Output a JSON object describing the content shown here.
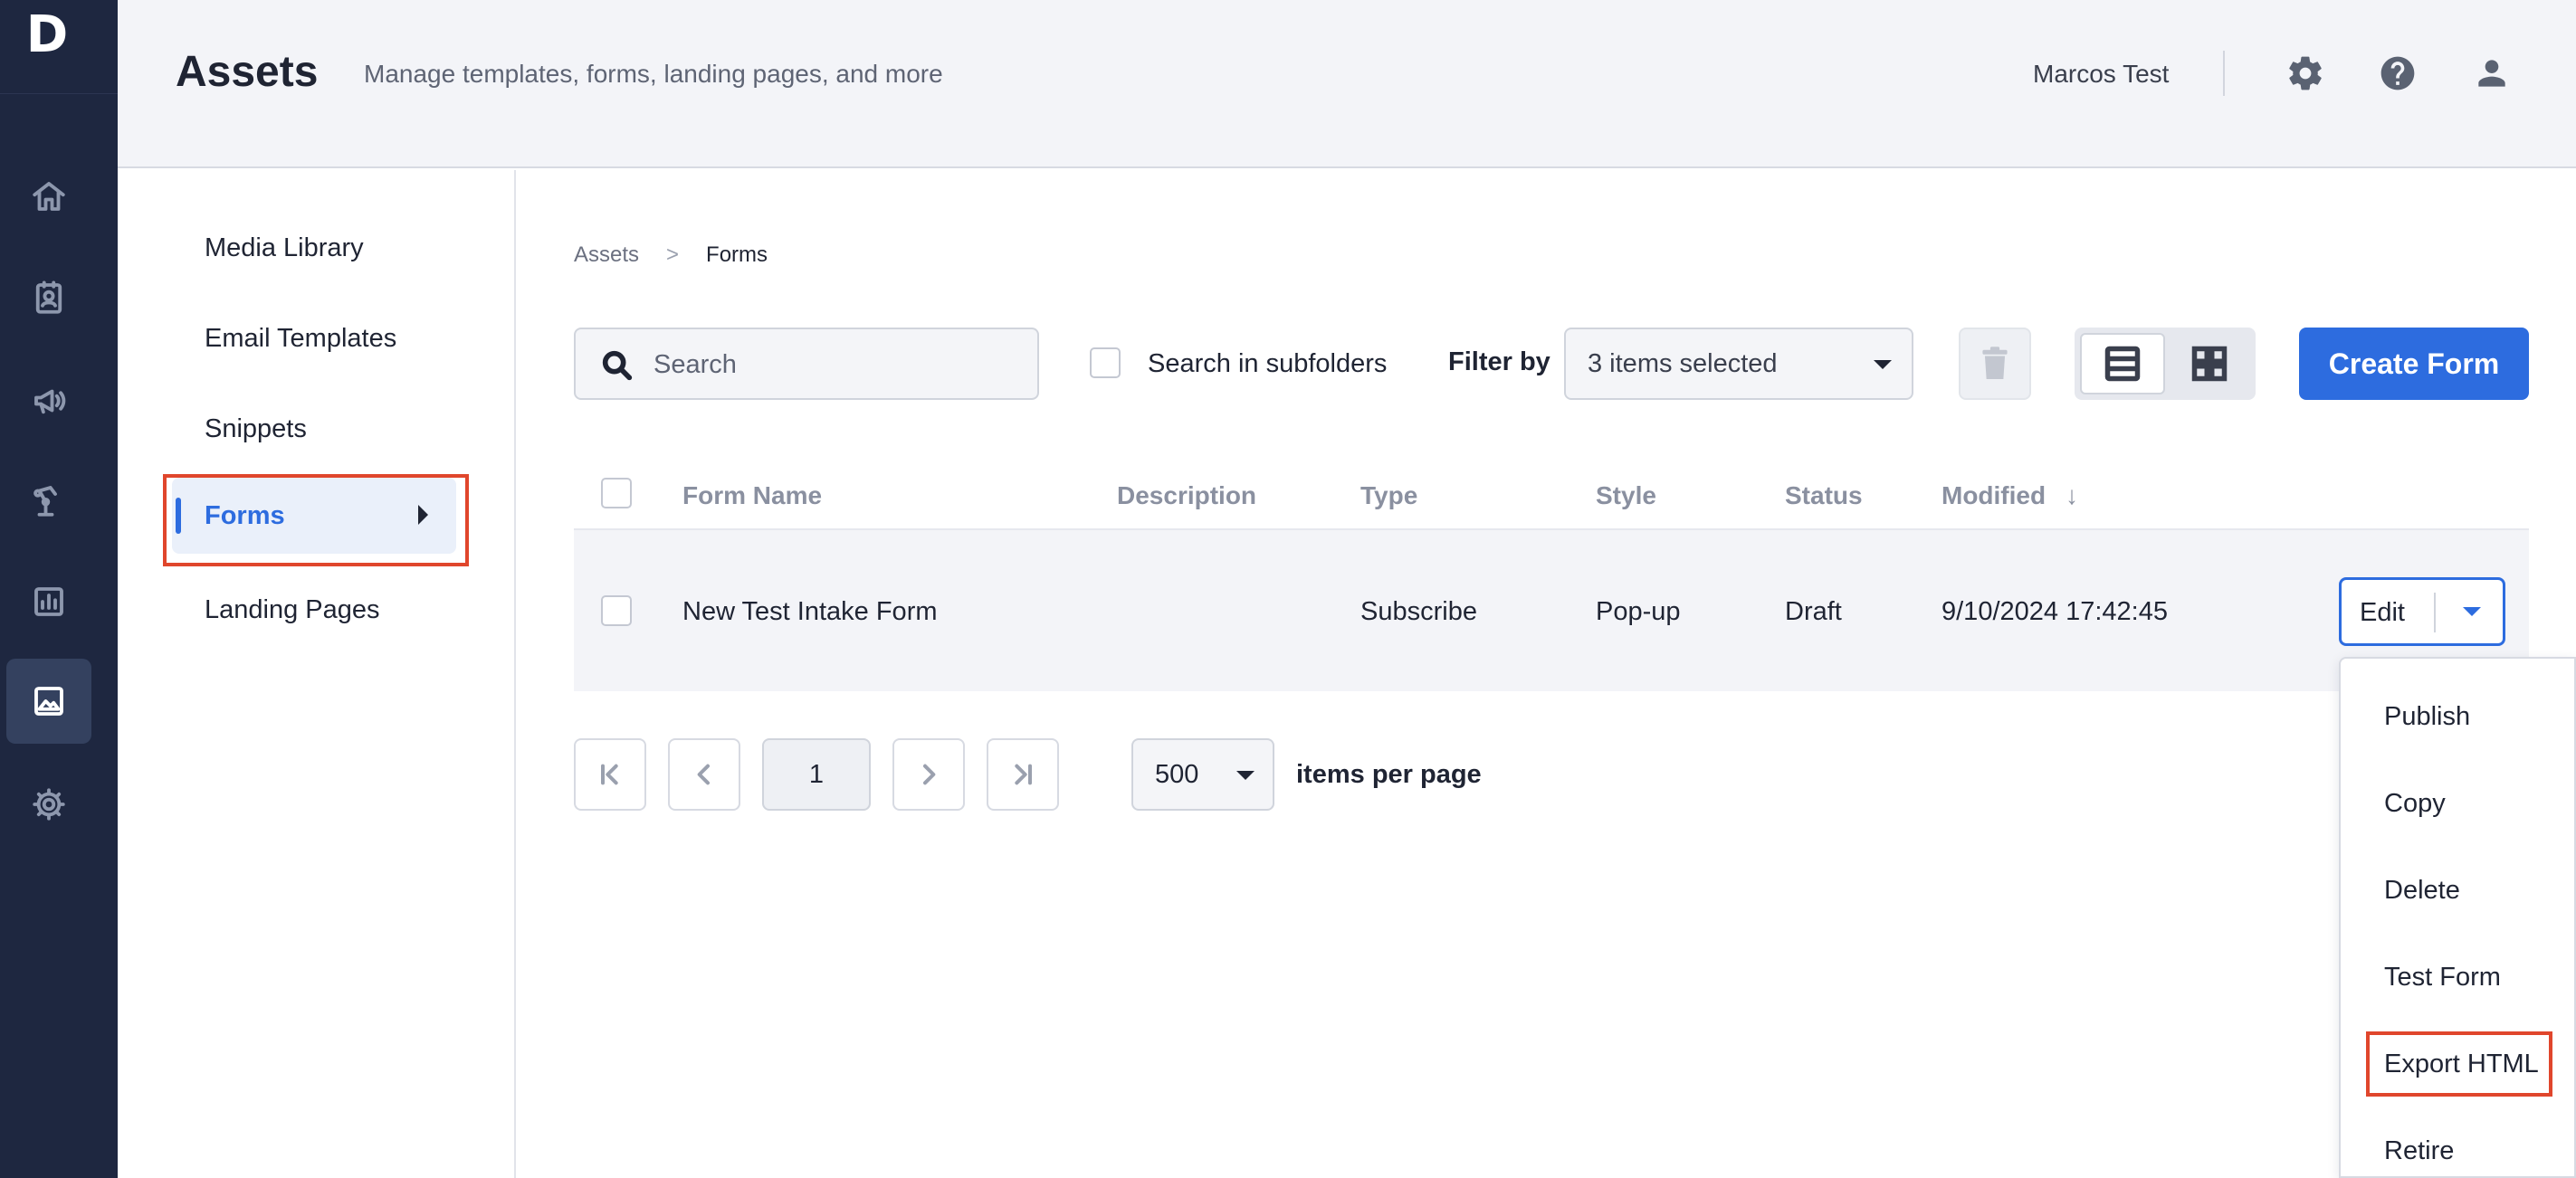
{
  "app": {
    "logo_letter": "D"
  },
  "rail": {
    "items": [
      {
        "icon": "home-icon"
      },
      {
        "icon": "contacts-icon"
      },
      {
        "icon": "megaphone-icon"
      },
      {
        "icon": "automation-icon"
      },
      {
        "icon": "reports-icon"
      },
      {
        "icon": "assets-image-icon",
        "active": true
      },
      {
        "icon": "settings-gear-icon"
      }
    ]
  },
  "header": {
    "title": "Assets",
    "subtitle": "Manage templates, forms, landing pages, and more",
    "user_name": "Marcos Test",
    "icons": [
      "gear-icon",
      "help-icon",
      "user-icon"
    ]
  },
  "subnav": {
    "items": [
      {
        "label": "Media Library"
      },
      {
        "label": "Email Templates"
      },
      {
        "label": "Snippets"
      },
      {
        "label": "Forms",
        "active": true
      },
      {
        "label": "Landing Pages"
      }
    ]
  },
  "breadcrumb": {
    "root": "Assets",
    "separator": ">",
    "current": "Forms"
  },
  "toolbar": {
    "search_placeholder": "Search",
    "subfolders_label": "Search in subfolders",
    "subfolders_checked": false,
    "filter_label": "Filter by",
    "filter_value": "3 items selected",
    "create_label": "Create Form"
  },
  "table": {
    "columns": [
      "Form Name",
      "Description",
      "Type",
      "Style",
      "Status",
      "Modified"
    ],
    "sort_indicator": "↓",
    "rows": [
      {
        "name": "New Test Intake Form",
        "description": "",
        "type": "Subscribe",
        "style": "Pop-up",
        "status": "Draft",
        "modified": "9/10/2024 17:42:45",
        "action": "Edit"
      }
    ]
  },
  "row_menu": {
    "items": [
      "Publish",
      "Copy",
      "Delete",
      "Test Form",
      "Export HTML",
      "Retire"
    ]
  },
  "pagination": {
    "current_page": "1",
    "per_page": "500",
    "per_page_label": "items per page"
  },
  "colors": {
    "accent": "#2d6cdf",
    "rail_bg": "#1e2740",
    "highlight": "#e0462c"
  }
}
